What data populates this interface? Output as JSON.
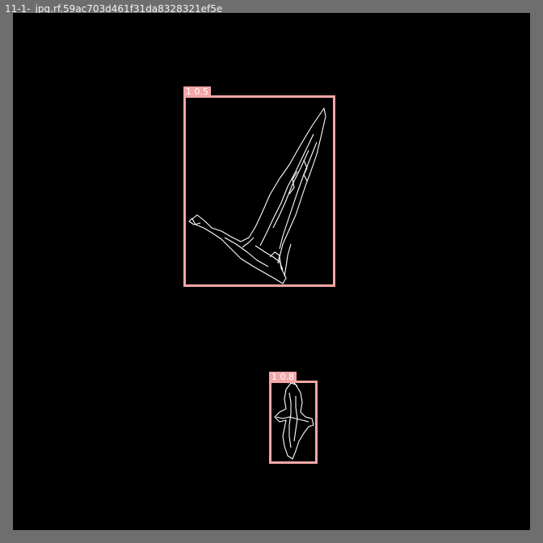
{
  "window": {
    "title": "11-1-_jpg.rf.59ac703d461f31da8328321ef5e"
  },
  "detections": [
    {
      "label": "1 0.5"
    },
    {
      "label": "1 0.8"
    }
  ],
  "colors": {
    "frame": "#6e6e6e",
    "canvas": "#000000",
    "box": "#f4a6a6",
    "edges": "#ffffff"
  }
}
